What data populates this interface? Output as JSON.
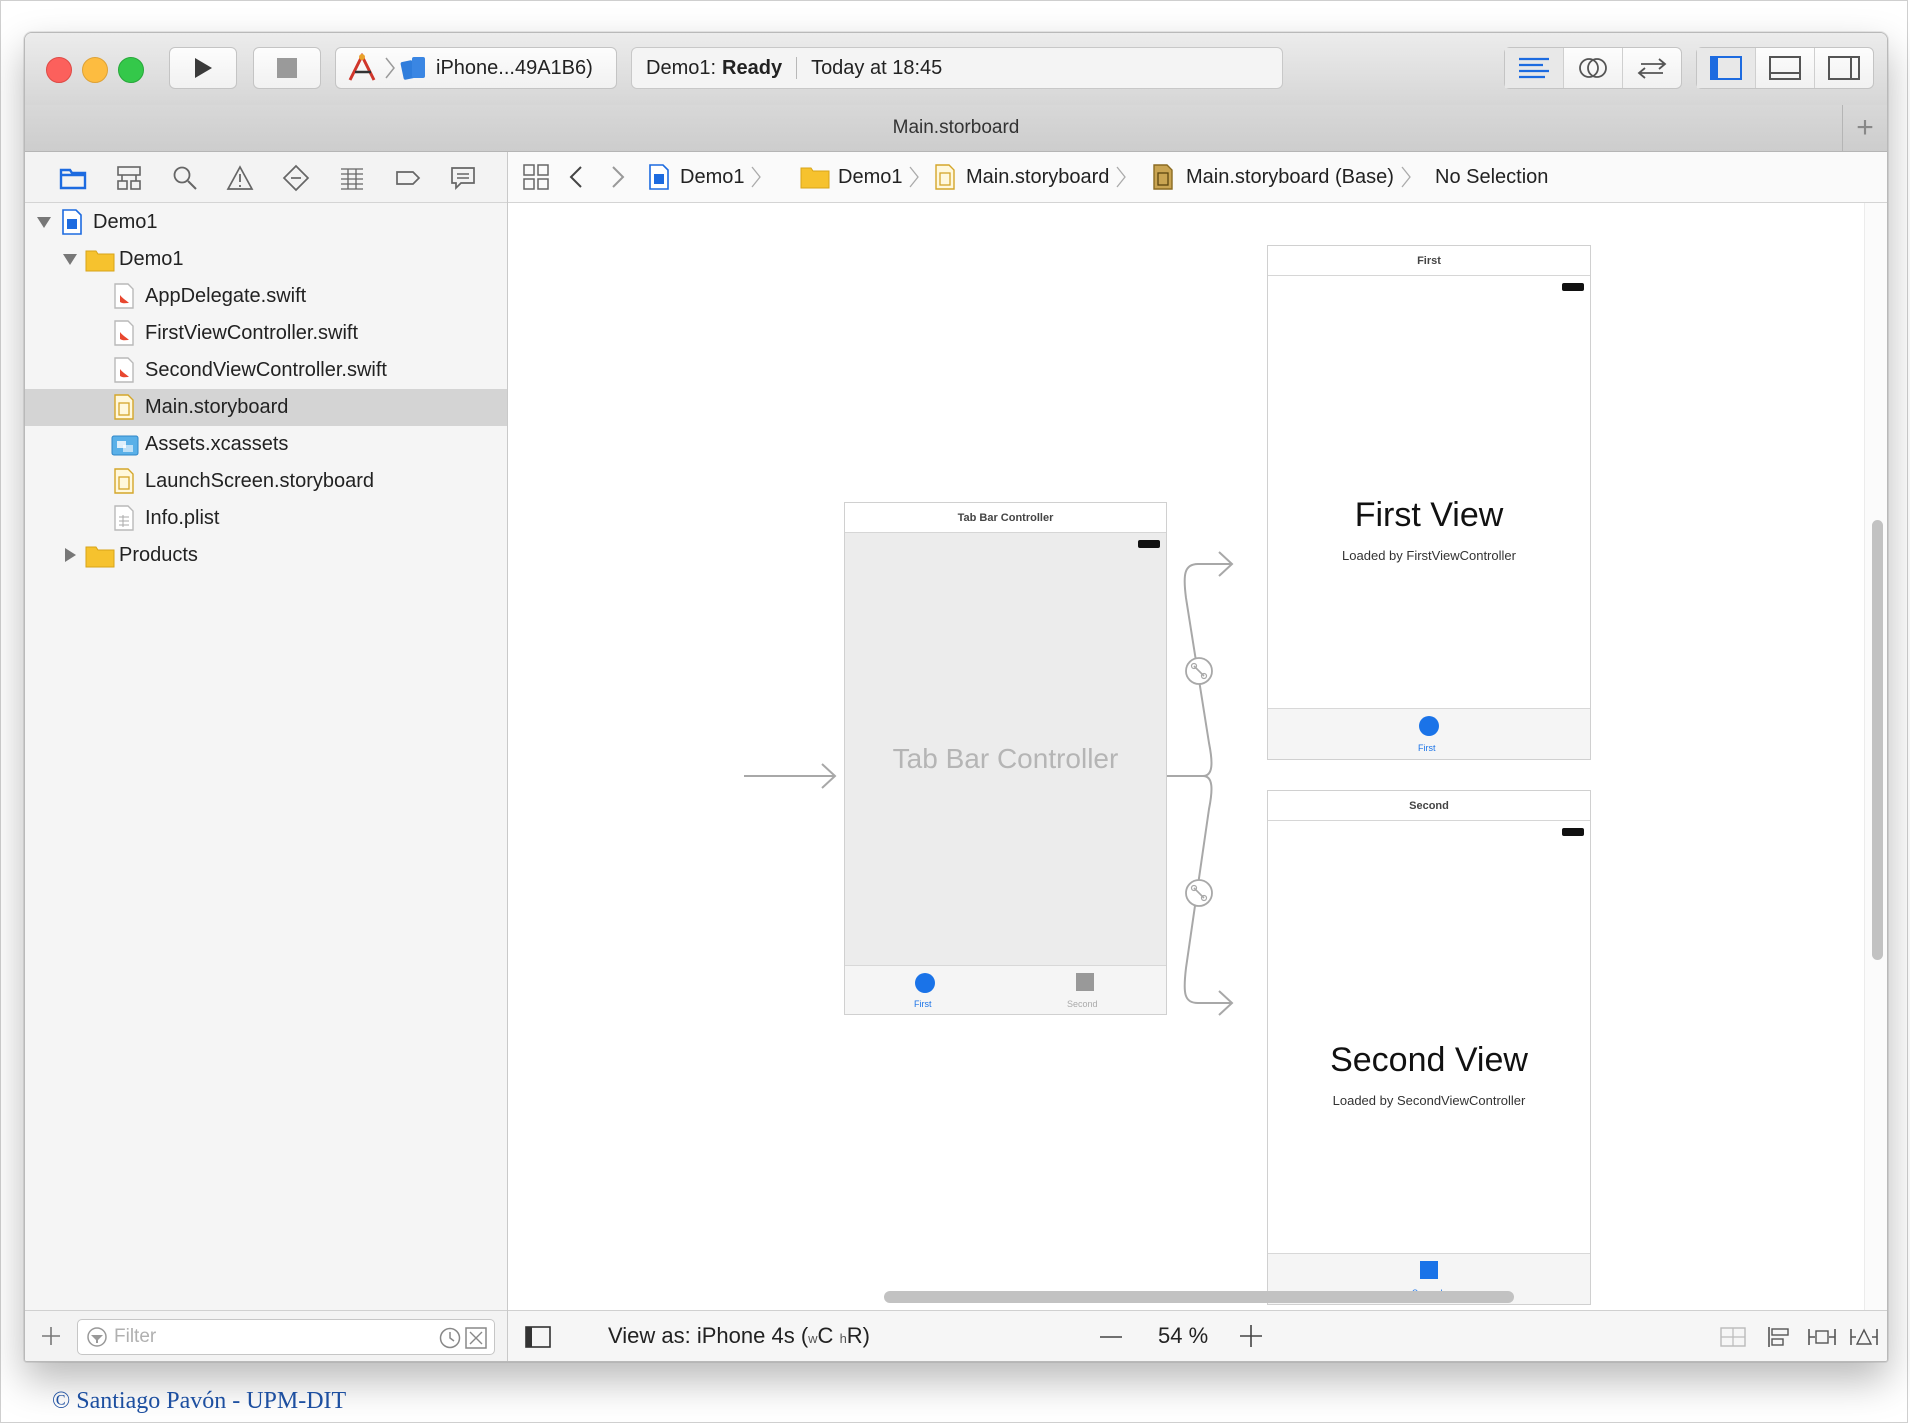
{
  "toolbar": {
    "scheme_device": "iPhone...49A1B6)",
    "activity_project": "Demo1: ",
    "activity_status": "Ready",
    "activity_time": "Today at 18:45"
  },
  "tab": {
    "title": "Main.storboard"
  },
  "navigator": {
    "tree": [
      {
        "label": "Demo1",
        "type": "project",
        "level": 0,
        "expanded": true
      },
      {
        "label": "Demo1",
        "type": "folder",
        "level": 1,
        "expanded": true
      },
      {
        "label": "AppDelegate.swift",
        "type": "swift",
        "level": 2
      },
      {
        "label": "FirstViewController.swift",
        "type": "swift",
        "level": 2
      },
      {
        "label": "SecondViewController.swift",
        "type": "swift",
        "level": 2
      },
      {
        "label": "Main.storyboard",
        "type": "storyboard",
        "level": 2,
        "selected": true
      },
      {
        "label": "Assets.xcassets",
        "type": "assets",
        "level": 2
      },
      {
        "label": "LaunchScreen.storyboard",
        "type": "storyboard",
        "level": 2
      },
      {
        "label": "Info.plist",
        "type": "plist",
        "level": 2
      },
      {
        "label": "Products",
        "type": "folder",
        "level": 1,
        "expanded": false
      }
    ],
    "filter_placeholder": "Filter"
  },
  "jumpbar": {
    "items": [
      "Demo1",
      "Demo1",
      "Main.storyboard",
      "Main.storyboard (Base)",
      "No Selection"
    ]
  },
  "canvas": {
    "tabbar_controller": {
      "title": "Tab Bar Controller",
      "center_label": "Tab Bar Controller",
      "tabs": [
        "First",
        "Second"
      ]
    },
    "first_scene": {
      "title": "First",
      "heading": "First View",
      "subtitle": "Loaded by FirstViewController",
      "tab": "First"
    },
    "second_scene": {
      "title": "Second",
      "heading": "Second View",
      "subtitle": "Loaded by SecondViewController",
      "tab": "Second"
    }
  },
  "editor_bottom": {
    "view_as_prefix": "View as: iPhone 4s (",
    "w_small": "w",
    "w_cap": "C",
    "h_small": "h",
    "h_cap": "R)",
    "zoom": "54 %"
  },
  "footer": {
    "copyright": "© Santiago Pavón - UPM-DIT"
  },
  "colors": {
    "accent": "#1a73e8",
    "selection": "#d4d4d4"
  }
}
